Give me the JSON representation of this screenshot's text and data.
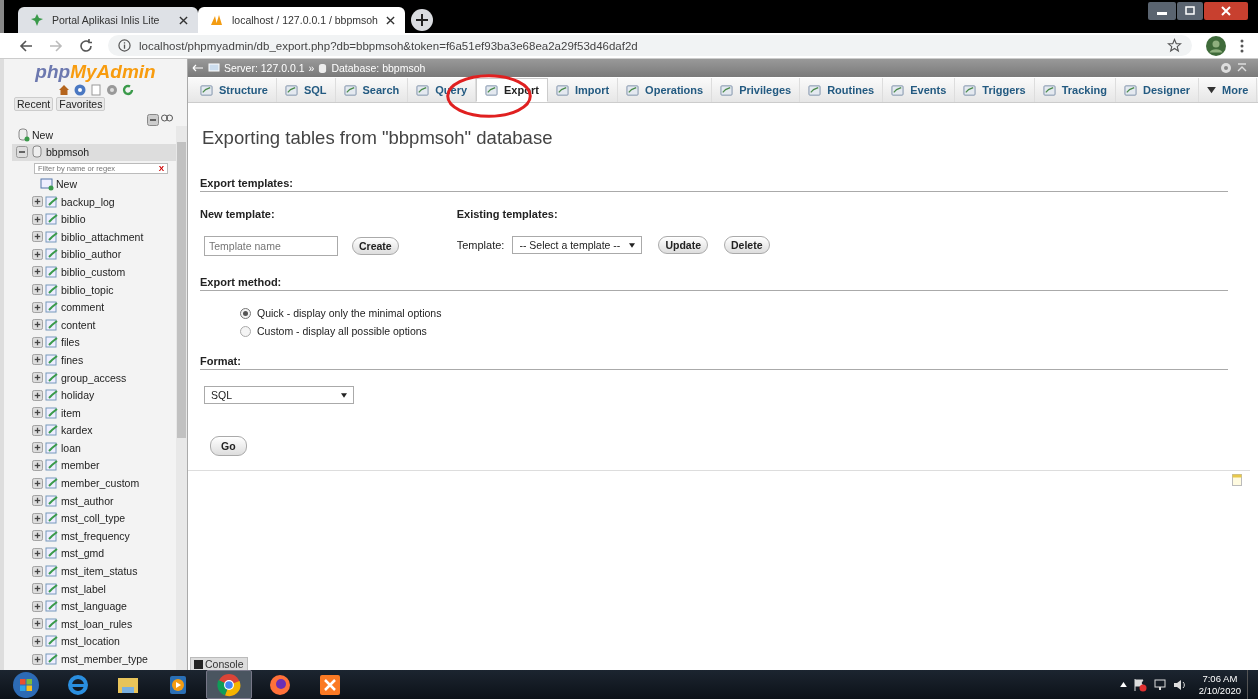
{
  "browser": {
    "tabs": [
      {
        "title": "Portal Aplikasi Inlis Lite",
        "selected": false
      },
      {
        "title": "localhost / 127.0.0.1 / bbpmsoh",
        "selected": true
      }
    ],
    "address": "localhost/phpmyadmin/db_export.php?db=bbpmsoh&token=f6a51ef93ba3e68ea2a29f53d46daf2d"
  },
  "sidebar": {
    "logo_php": "php",
    "logo_brand": "MyAdmin",
    "tabs": [
      "Recent",
      "Favorites"
    ],
    "tree": {
      "new": "New",
      "database": {
        "name": "bbpmsoh",
        "expanded": true,
        "filter_placeholder": "Filter by name or regex",
        "clear": "X",
        "new_table": "New",
        "tables": [
          "backup_log",
          "biblio",
          "biblio_attachment",
          "biblio_author",
          "biblio_custom",
          "biblio_topic",
          "comment",
          "content",
          "files",
          "fines",
          "group_access",
          "holiday",
          "item",
          "kardex",
          "loan",
          "member",
          "member_custom",
          "mst_author",
          "mst_coll_type",
          "mst_frequency",
          "mst_gmd",
          "mst_item_status",
          "mst_label",
          "mst_language",
          "mst_loan_rules",
          "mst_location",
          "mst_member_type"
        ]
      }
    }
  },
  "breadcrumb": {
    "server": "Server: 127.0.0.1",
    "separator": "»",
    "database": "Database: bbpmsoh"
  },
  "nav_tabs": [
    {
      "label": "Structure",
      "selected": false
    },
    {
      "label": "SQL",
      "selected": false
    },
    {
      "label": "Search",
      "selected": false
    },
    {
      "label": "Query",
      "selected": false
    },
    {
      "label": "Export",
      "selected": true
    },
    {
      "label": "Import",
      "selected": false
    },
    {
      "label": "Operations",
      "selected": false
    },
    {
      "label": "Privileges",
      "selected": false
    },
    {
      "label": "Routines",
      "selected": false
    },
    {
      "label": "Events",
      "selected": false
    },
    {
      "label": "Triggers",
      "selected": false
    },
    {
      "label": "Tracking",
      "selected": false
    },
    {
      "label": "Designer",
      "selected": false
    },
    {
      "label": "More",
      "selected": false
    }
  ],
  "page": {
    "title": "Exporting tables from \"bbpmsoh\" database",
    "templates": {
      "heading": "Export templates:",
      "new_label": "New template:",
      "name_placeholder": "Template name",
      "create": "Create",
      "existing_label": "Existing templates:",
      "template_label": "Template:",
      "template_select": "-- Select a template --",
      "update": "Update",
      "delete": "Delete"
    },
    "method": {
      "heading": "Export method:",
      "options": [
        {
          "label": "Quick - display only the minimal options",
          "selected": true
        },
        {
          "label": "Custom - display all possible options",
          "selected": false
        }
      ]
    },
    "format": {
      "heading": "Format:",
      "value": "SQL"
    },
    "go": "Go"
  },
  "console": "Console",
  "taskbar": {
    "apps": [
      {
        "kind": "ie",
        "active": false
      },
      {
        "kind": "folder",
        "active": false
      },
      {
        "kind": "media",
        "active": false
      },
      {
        "kind": "chrome",
        "active": true
      },
      {
        "kind": "firefox",
        "active": false
      },
      {
        "kind": "xampp",
        "active": false
      }
    ],
    "time": "7:06 AM",
    "date": "2/10/2020"
  }
}
